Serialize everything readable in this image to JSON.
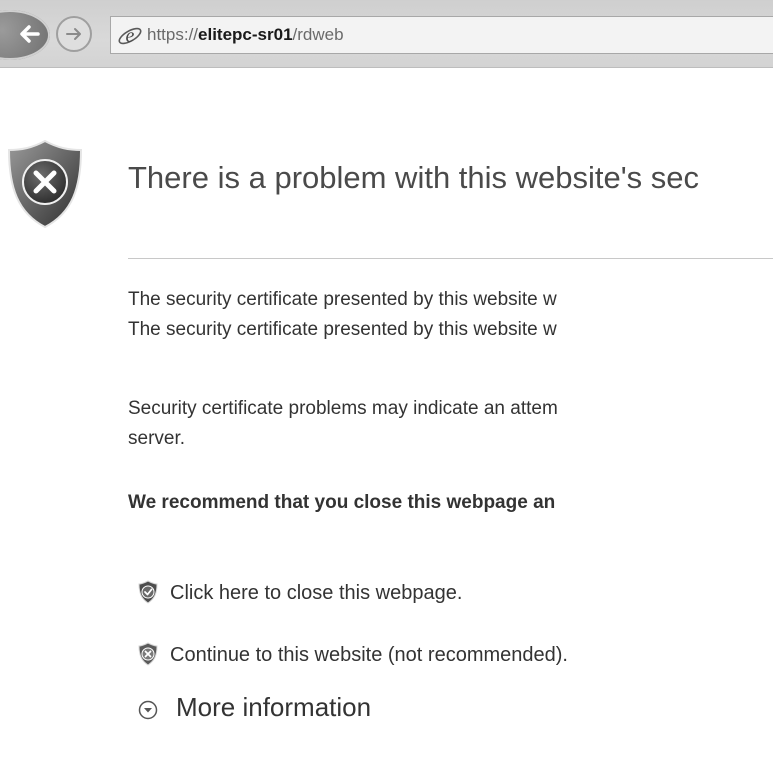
{
  "browser": {
    "address": {
      "scheme": "https://",
      "host": "elitepc-sr01",
      "path": "/rdweb"
    },
    "icons": {
      "back": "back-arrow-icon",
      "forward": "forward-arrow-icon",
      "site": "internet-explorer-icon"
    }
  },
  "error": {
    "shield_icon": "error-shield-icon",
    "title": "There is a problem with this website's sec",
    "paragraphs": [
      "The security certificate presented by this website w",
      "The security certificate presented by this website w",
      "Security certificate problems may indicate an attem",
      "server."
    ],
    "recommendation": "We recommend that you close this webpage an",
    "actions": [
      {
        "label": "Click here to close this webpage.",
        "icon": "green-check-shield-icon"
      },
      {
        "label": "Continue to this website (not recommended).",
        "icon": "red-x-shield-icon"
      }
    ],
    "more_info": {
      "label": "More information",
      "icon": "chevron-down-circle-icon"
    }
  }
}
